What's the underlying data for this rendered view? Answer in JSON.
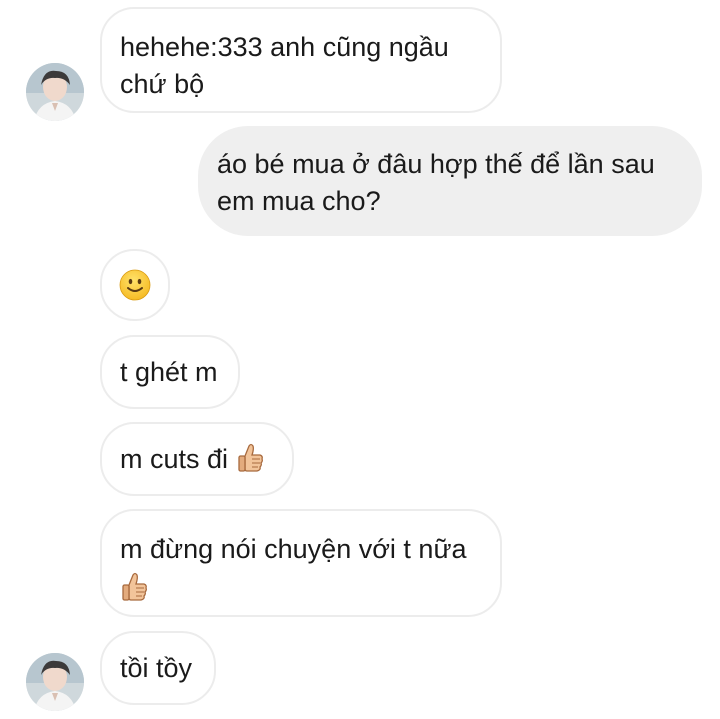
{
  "messages": [
    {
      "id": "m1",
      "side": "in",
      "lines": [
        "hehehe:333 anh cũng ngầu",
        "chứ bộ"
      ]
    },
    {
      "id": "m2",
      "side": "out",
      "lines": [
        "áo bé mua ở đâu hợp thế để lần sau",
        "em mua cho?"
      ]
    },
    {
      "id": "m3",
      "side": "in",
      "emoji": "slightly-smiling-face"
    },
    {
      "id": "m4",
      "side": "in",
      "text": "t ghét m"
    },
    {
      "id": "m5",
      "side": "in",
      "text": "m cuts đi",
      "emoji": "thumbs-up"
    },
    {
      "id": "m6",
      "side": "in",
      "text": "m đừng nói chuyện với t nữa",
      "emoji": "thumbs-up"
    },
    {
      "id": "m7",
      "side": "in",
      "text": "tồi tồy"
    }
  ],
  "colors": {
    "incoming_bubble": "#ffffff",
    "incoming_border": "#ececec",
    "outgoing_bubble": "#efefef",
    "text": "#1a1a1a"
  }
}
